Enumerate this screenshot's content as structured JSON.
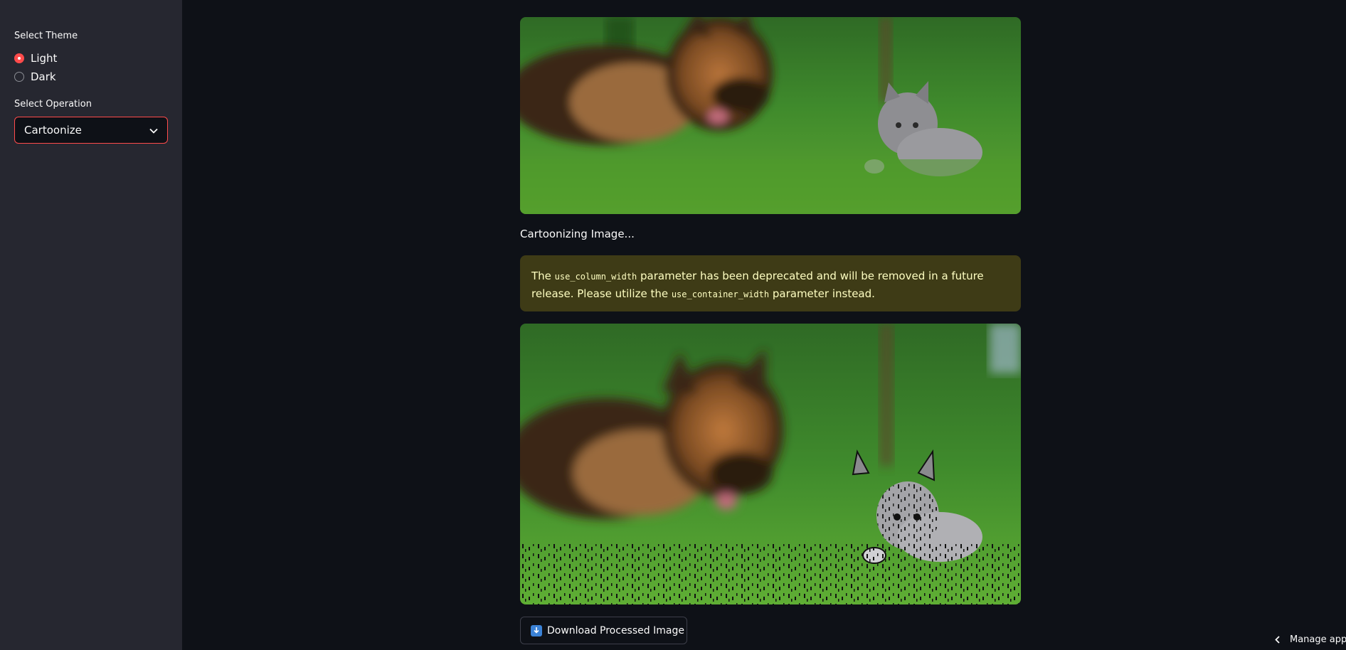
{
  "sidebar": {
    "theme_label": "Select Theme",
    "theme_options": [
      "Light",
      "Dark"
    ],
    "theme_selected": "Light",
    "operation_label": "Select Operation",
    "operation_value": "Cartoonize"
  },
  "main": {
    "status_text": "Cartoonizing Image...",
    "warning": {
      "part1": "The ",
      "code1": "use_column_width",
      "part2": " parameter has been deprecated and will be removed in a future release. Please utilize the ",
      "code2": "use_container_width",
      "part3": " parameter instead."
    },
    "download_label": "Download Processed Image"
  },
  "footer": {
    "manage_app_label": "Manage app"
  },
  "colors": {
    "background": "#0e1117",
    "sidebar": "#262730",
    "accent": "#ff4b4b",
    "warning_bg": "#3e3b16",
    "warning_text": "#ffffc2"
  },
  "icons": {
    "dropdown": "chevron-down-icon",
    "download": "download-arrow-icon",
    "manage": "chevron-left-icon"
  }
}
